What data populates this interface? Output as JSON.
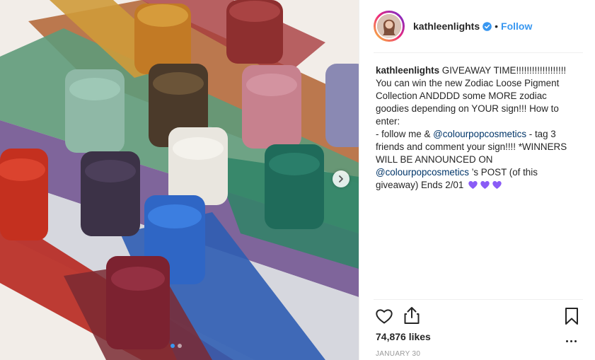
{
  "post": {
    "image_alt": "Glitter pigment jars with colorful swatches",
    "dots": 2,
    "active_dot": 0
  },
  "header": {
    "username": "kathleenlights",
    "separator": "•",
    "follow_label": "Follow",
    "accent": "#3897f0"
  },
  "caption": {
    "username": "kathleenlights",
    "line1": "GIVEAWAY TIME!!!!!!!!!!!!!!!!!!! You can win the new Zodiac Loose Pigment Collection ANDDDD some MORE zodiac goodies depending on YOUR sign!!! How to enter:",
    "line2_prefix": "- follow me & ",
    "mention1": "@colourpopcosmetics",
    "line2_suffix": " - tag 3 friends and comment your sign!!!! *WINNERS WILL BE ANNOUNCED ON ",
    "mention2": "@colourpopcosmetics",
    "line3_suffix": " ’s POST (of this giveaway) Ends 2/01",
    "heart_color": "#8a5cf6"
  },
  "footer": {
    "likes": "74,876 likes",
    "date": "JANUARY 30"
  },
  "icons": {
    "like": "heart-outline-icon",
    "share": "share-icon",
    "save": "bookmark-icon",
    "more": "more-options-icon",
    "next": "chevron-right-icon",
    "verified": "verified-badge-icon"
  }
}
